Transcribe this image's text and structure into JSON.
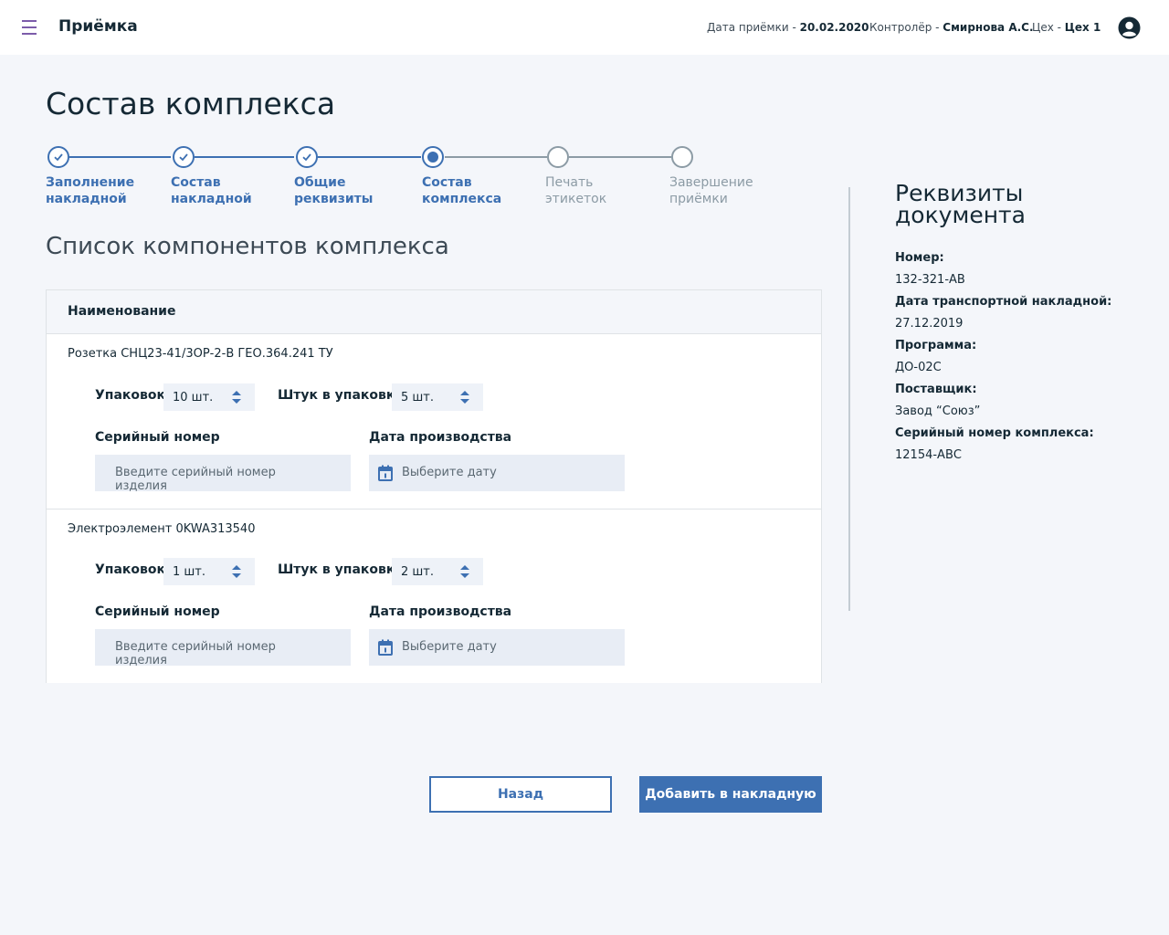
{
  "header": {
    "app_title": "Приёмка",
    "date_label": "Дата приёмки - ",
    "date_value": "20.02.2020",
    "controller_label": "Контролёр - ",
    "controller_value": "Смирнова А.С.",
    "shop_label": "Цех - ",
    "shop_value": "Цех 1"
  },
  "page_title": "Состав комплекса",
  "stepper": {
    "steps": [
      {
        "line1": "Заполнение",
        "line2": "накладной",
        "state": "done"
      },
      {
        "line1": "Состав",
        "line2": "накладной",
        "state": "done"
      },
      {
        "line1": "Общие",
        "line2": "реквизиты",
        "state": "done"
      },
      {
        "line1": "Состав",
        "line2": "комплекса",
        "state": "current"
      },
      {
        "line1": "Печать",
        "line2": "этикеток",
        "state": "todo"
      },
      {
        "line1": "Завершение",
        "line2": "приёмки",
        "state": "todo"
      }
    ]
  },
  "section_title": "Список компонентов комплекса",
  "table": {
    "header": "Наименование",
    "rows": [
      {
        "name": "Розетка СНЦ23-41/3ОР-2-В ГЕО.364.241 ТУ",
        "packs_label": "Упаковок",
        "packs_value": "10 шт.",
        "per_pack_label": "Штук в упаковке",
        "per_pack_value": "5 шт.",
        "serial_label": "Серийный номер",
        "serial_placeholder": "Введите серийный номер изделия",
        "date_label": "Дата производства",
        "date_placeholder": "Выберите дату"
      },
      {
        "name": "Электроэлемент 0KWA313540",
        "packs_label": "Упаковок",
        "packs_value": "1 шт.",
        "per_pack_label": "Штук в упаковке",
        "per_pack_value": "2 шт.",
        "serial_label": "Серийный номер",
        "serial_placeholder": "Введите серийный номер изделия",
        "date_label": "Дата производства",
        "date_placeholder": "Выберите дату"
      }
    ]
  },
  "details": {
    "title": "Реквизиты документа",
    "fields": [
      {
        "label": "Номер:",
        "value": "132-321-АВ"
      },
      {
        "label": "Дата транспортной накладной:",
        "value": "27.12.2019"
      },
      {
        "label": "Программа:",
        "value": "ДО-02С"
      },
      {
        "label": "Поставщик:",
        "value": "Завод “Союз”"
      },
      {
        "label": "Серийный номер комплекса:",
        "value": "12154-АВС"
      }
    ]
  },
  "buttons": {
    "back": "Назад",
    "add": "Добавить в накладную"
  },
  "colors": {
    "accent": "#3d70b2",
    "menu": "#7c5caa",
    "inactive": "#8c9ba5",
    "background": "#f4f6fa",
    "input_bg": "#e8edf5"
  },
  "icons": [
    "menu-icon",
    "user-avatar-icon",
    "checkmark-icon",
    "sort-arrows-icon",
    "calendar-icon"
  ]
}
